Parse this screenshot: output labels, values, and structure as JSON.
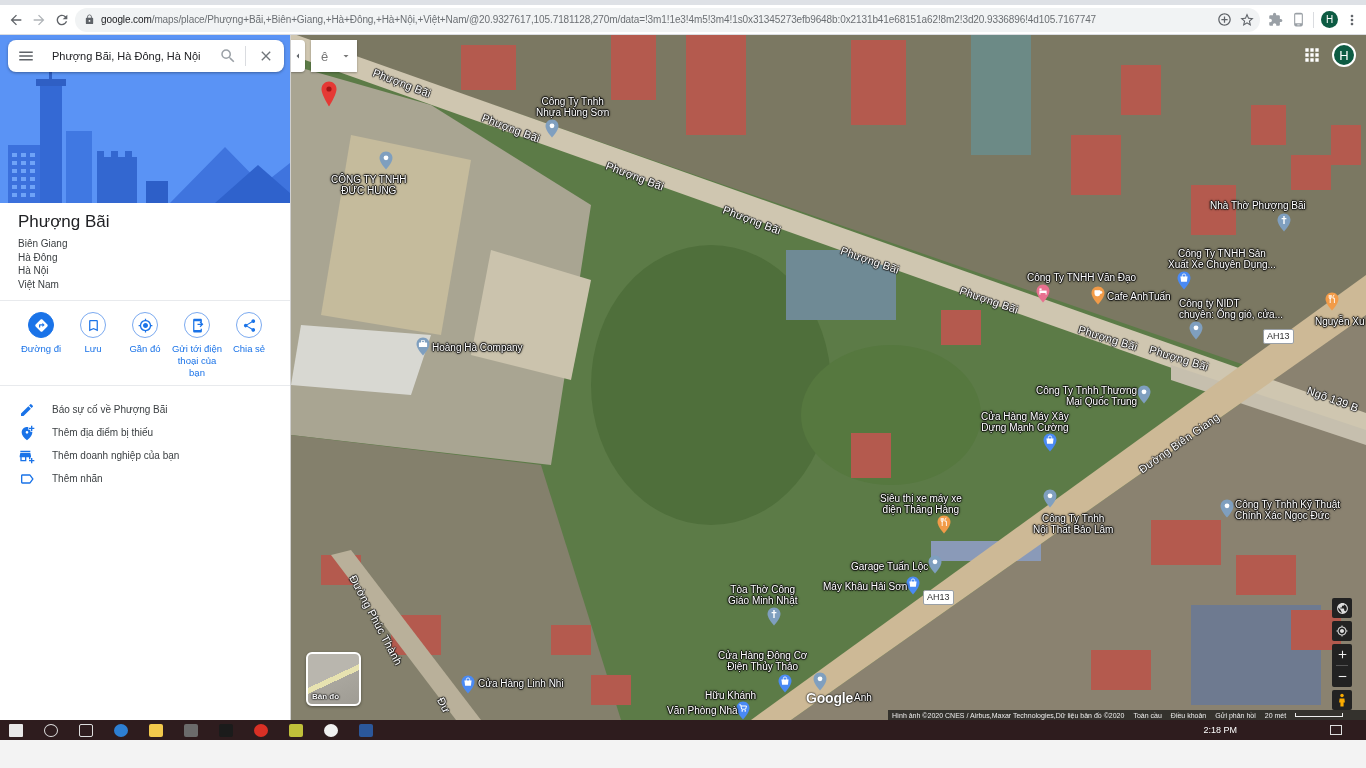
{
  "browser": {
    "url": {
      "host": "google.com",
      "path": "/maps/place/Phượng+Bãi,+Biên+Giang,+Hà+Đông,+Hà+Nội,+Việt+Nam/@20.9327617,105.7181128,270m/data=!3m1!1e3!4m5!3m4!1s0x31345273efb9648b:0x2131b41e68151a62!8m2!3d20.9336896!4d105.7167747"
    },
    "profile_initial": "H"
  },
  "search": {
    "value": "Phượng Bãi, Hà Đông, Hà Nội"
  },
  "place": {
    "title": "Phượng Bãi",
    "address_lines": [
      "Biên Giang",
      "Hà Đông",
      "Hà Nội",
      "Việt Nam"
    ]
  },
  "actions": [
    {
      "label": "Đường đi",
      "kind": "directions",
      "filled": true
    },
    {
      "label": "Lưu",
      "kind": "save",
      "filled": false
    },
    {
      "label": "Gần đó",
      "kind": "nearby",
      "filled": false
    },
    {
      "label": "Gửi tới điện thoại của bạn",
      "kind": "send",
      "filled": false
    },
    {
      "label": "Chia sẻ",
      "kind": "share",
      "filled": false
    }
  ],
  "links": [
    {
      "label": "Báo sự cố về Phượng Bãi",
      "kind": "edit"
    },
    {
      "label": "Thêm địa điểm bị thiếu",
      "kind": "add-place"
    },
    {
      "label": "Thêm doanh nghiệp của bạn",
      "kind": "add-business"
    },
    {
      "label": "Thêm nhãn",
      "kind": "label"
    }
  ],
  "input_mode": {
    "label": "ê"
  },
  "map": {
    "account_initial": "H",
    "road_labels": [
      "Phượng Bãi",
      "Phượng Bãi",
      "Phượng Bãi",
      "Phượng Bãi",
      "Phượng Bãi",
      "Phượng Bãi",
      "Phượng Bãi",
      "Phượng Bãi",
      "Ngõ 139 B",
      "Đường Biên Giang",
      "Đường Phúc Thành",
      "Đư"
    ],
    "route_shields": [
      "AH13",
      "AH13"
    ],
    "places": [
      {
        "lines": [
          "Công Ty Tnhh",
          "Nhựa Hùng Sơn"
        ],
        "kind": "dot",
        "color": "#7f9fbf"
      },
      {
        "lines": [
          "CÔNG TY TNHH",
          "ĐỨC HUNG"
        ],
        "kind": "dot",
        "color": "#7f9fbf"
      },
      {
        "lines": [
          "Hoàng Hà Company"
        ],
        "kind": "office",
        "color": "#7f9fbf"
      },
      {
        "lines": [
          "Nhà Thờ Phượng Bãi"
        ],
        "kind": "cross",
        "color": "#7f9fbf"
      },
      {
        "lines": [
          "Công Ty TNHH Sản",
          "Xuất Xe Chuyên Dụng..."
        ],
        "kind": "shop",
        "color": "#4a8af4"
      },
      {
        "lines": [
          "Công Ty TNHH Văn Đạo"
        ],
        "kind": "bed",
        "color": "#e8708f"
      },
      {
        "lines": [
          "Cafe AnhTuấn"
        ],
        "kind": "cup",
        "color": "#f29b48"
      },
      {
        "lines": [
          "Công ty NIDT",
          "chuyên: Ống gió, cửa..."
        ],
        "kind": "dot",
        "color": "#7f9fbf"
      },
      {
        "lines": [
          "Nguyễn Xu"
        ],
        "kind": "food",
        "color": "#f29b48"
      },
      {
        "lines": [
          "Công Ty Tnhh Thương",
          "Mại Quốc Trung"
        ],
        "kind": "dot",
        "color": "#7f9fbf"
      },
      {
        "lines": [
          "Cửa Hàng Máy Xây",
          "Dựng Mạnh Cường"
        ],
        "kind": "shop",
        "color": "#4a8af4"
      },
      {
        "lines": [
          "Siêu thị xe máy xe",
          "điện Thăng Hàng"
        ],
        "kind": "food",
        "color": "#f29b48"
      },
      {
        "lines": [
          "Công Ty Tnhh",
          "Nội Thất Bảo Lâm"
        ],
        "kind": "dot",
        "color": "#7f9fbf"
      },
      {
        "lines": [
          "Công Ty Tnhh Kỹ Thuật",
          "Chính Xác Ngọc Đức"
        ],
        "kind": "dot",
        "color": "#7f9fbf"
      },
      {
        "lines": [
          "Garage Tuấn Lộc"
        ],
        "kind": "dot",
        "color": "#7f9fbf"
      },
      {
        "lines": [
          "Tòa Thờ Công",
          "Giáo Minh Nhật"
        ],
        "kind": "cross",
        "color": "#7f9fbf"
      },
      {
        "lines": [
          "Máy Khâu Hải Sơn"
        ],
        "kind": "shop",
        "color": "#4a8af4"
      },
      {
        "lines": [
          "Cửa Hàng Động Cơ",
          "Điện Thủy Thảo"
        ],
        "kind": "shop",
        "color": "#4a8af4"
      },
      {
        "kind": "dot",
        "color": "#7f9fbf"
      },
      {
        "lines": [
          "Cửa Hàng Linh Nhi"
        ],
        "kind": "shop",
        "color": "#4a8af4"
      },
      {
        "lines": [
          "Hữu Khánh"
        ],
        "kind": "cart",
        "color": "#4a8af4"
      },
      {
        "lines": [
          "Văn Phòng Nhà"
        ],
        "kind": "none"
      },
      {
        "lines": [
          "Anh"
        ],
        "kind": "none"
      }
    ],
    "logo": "Google",
    "layer_toggle": {
      "label": "Bản đồ"
    },
    "attribution": {
      "imagery": "Hình ảnh ©2020 CNES / Airbus,Maxar Technologies,Dữ liệu bản đồ ©2020",
      "links": [
        "Toàn cầu",
        "Điều khoản",
        "Gửi phản hồi"
      ],
      "scale": "20 mét"
    }
  },
  "taskbar": {
    "time": "2:18 PM"
  }
}
